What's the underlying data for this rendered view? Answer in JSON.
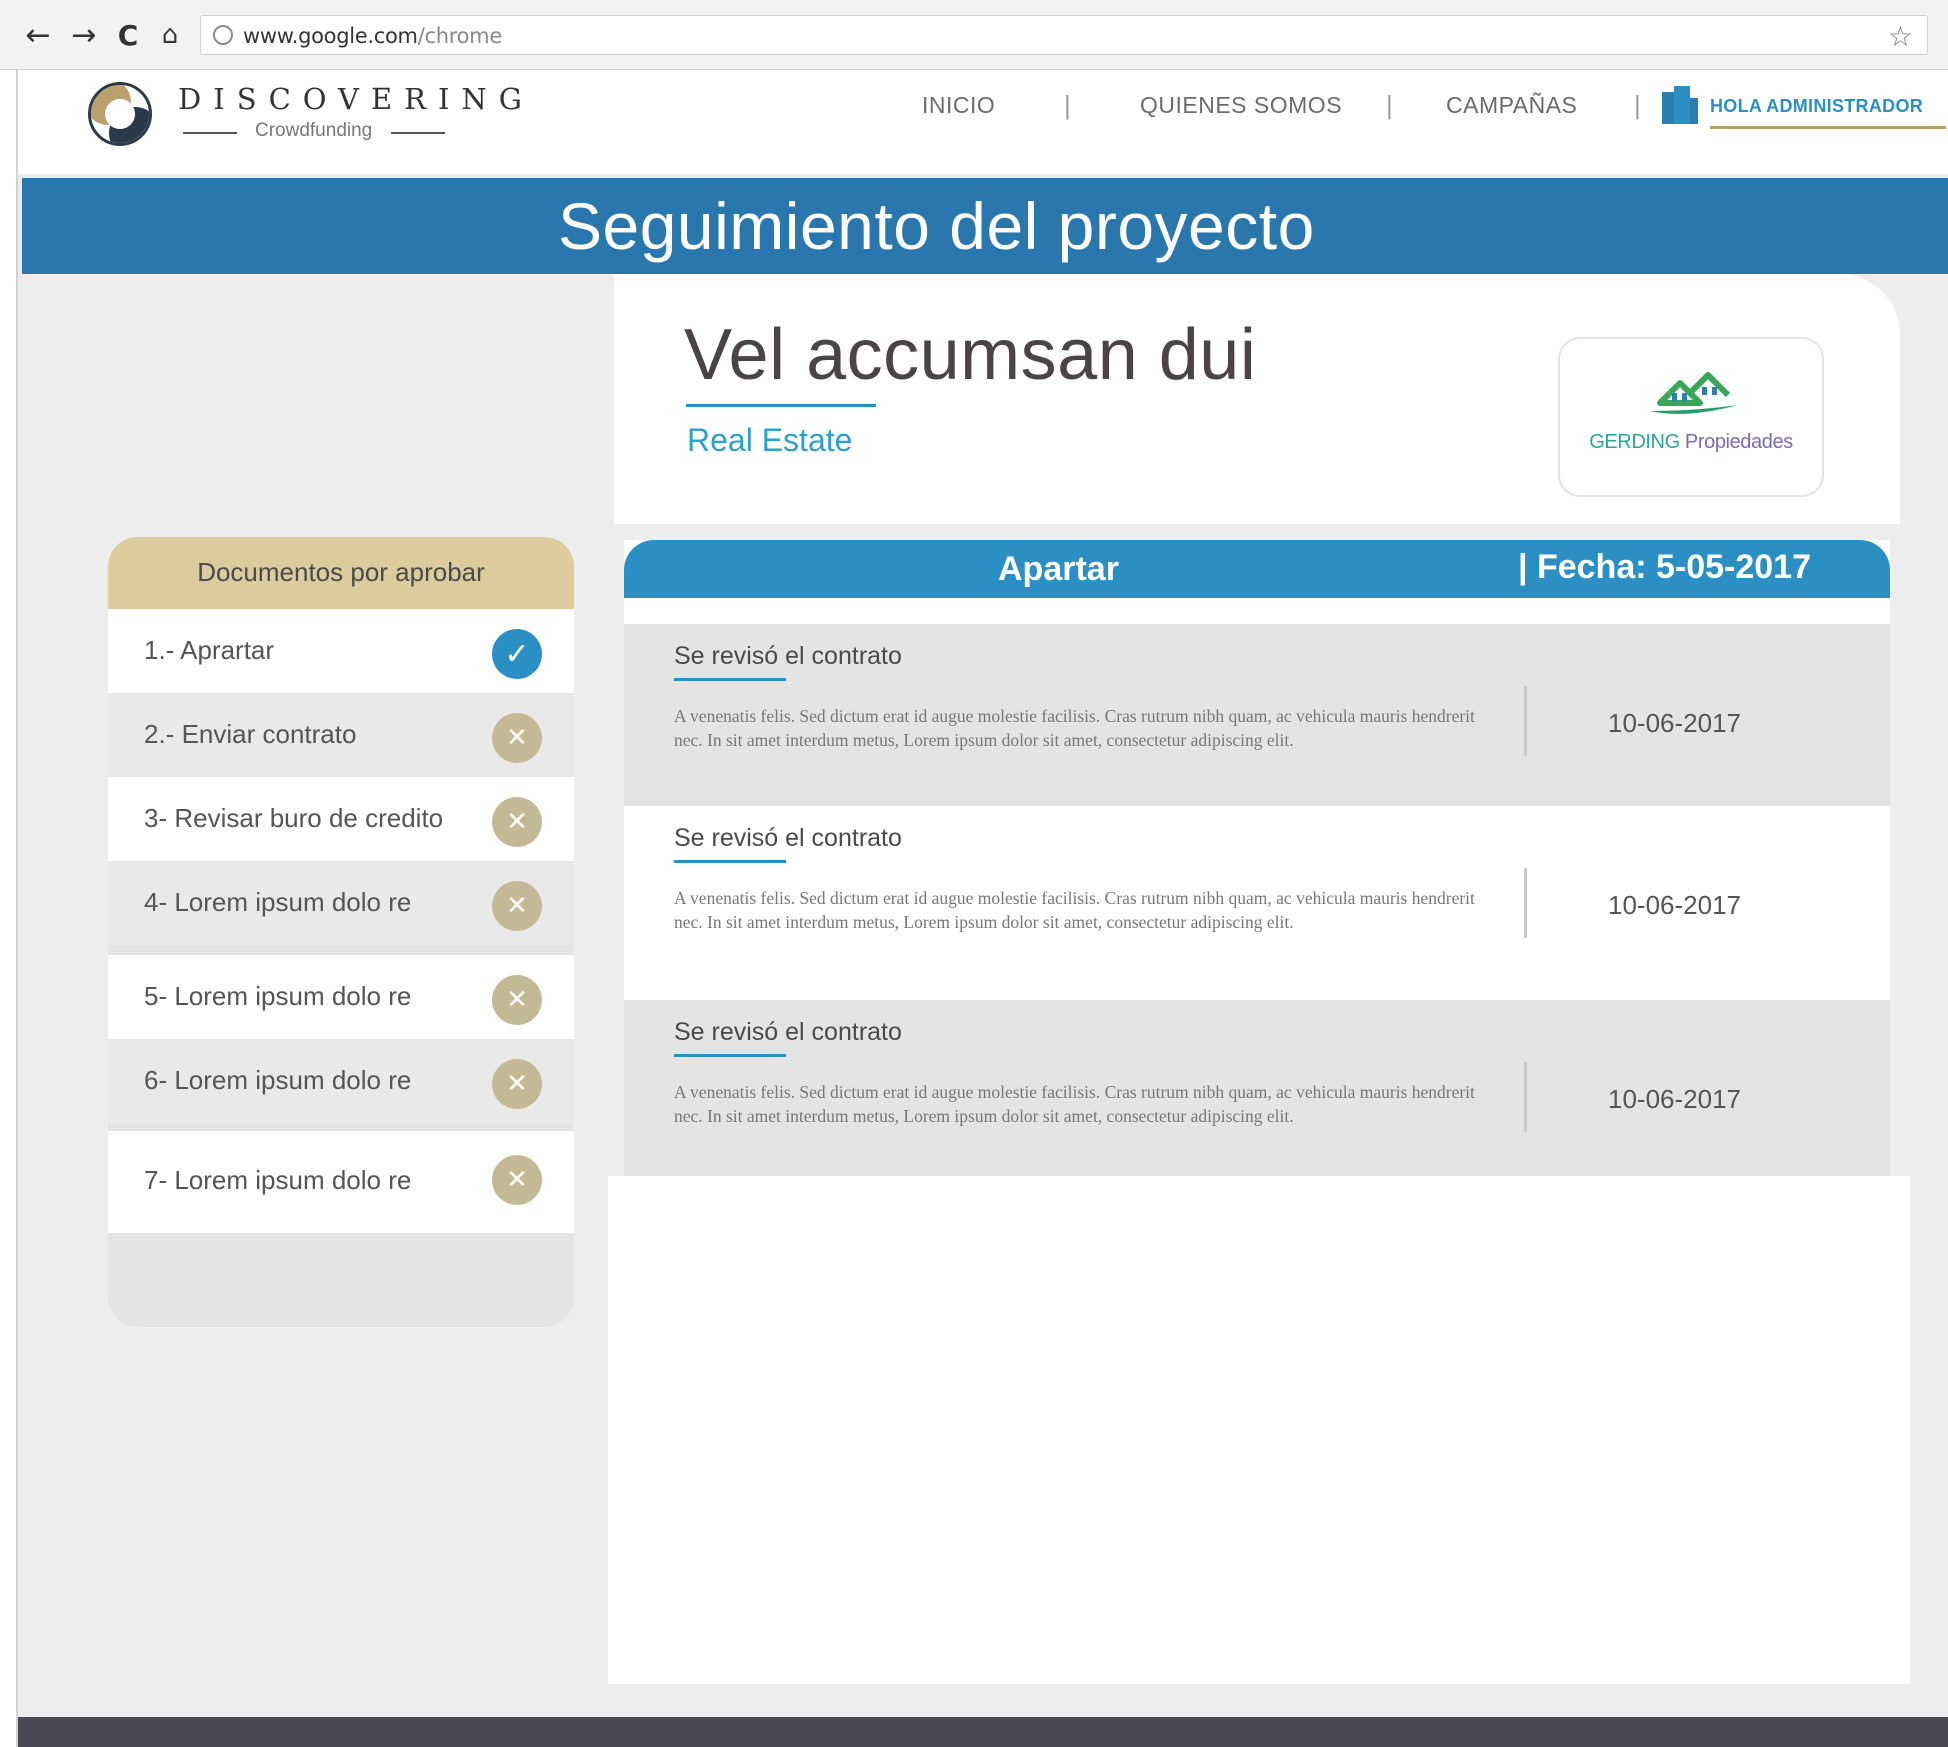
{
  "browser": {
    "back_icon": "arrow-left-icon",
    "forward_icon": "arrow-right-icon",
    "reload_icon": "reload-icon",
    "home_icon": "home-icon",
    "url_host": "www.google.com",
    "url_path": "/chrome",
    "bookmark_icon": "star-icon"
  },
  "header": {
    "brand_name": "DISCOVERING",
    "brand_tagline": "Crowdfunding",
    "nav": [
      {
        "label": "INICIO"
      },
      {
        "label": "QUIENES SOMOS"
      },
      {
        "label": "CAMPAÑAS"
      }
    ],
    "separator": "|",
    "admin_label": "HOLA ADMINISTRADOR",
    "admin_icon": "building-icon"
  },
  "title_band": {
    "title": "Seguimiento del proyecto"
  },
  "project": {
    "title": "Vel accumsan dui",
    "category": "Real Estate",
    "partner_logo": {
      "name_part1": "GERDING",
      "name_part2": " Propiedades"
    }
  },
  "sidebar": {
    "title": "Documentos por aprobar",
    "items": [
      {
        "label": "1.- Aprartar",
        "status": "done"
      },
      {
        "label": "2.- Enviar contrato",
        "status": "pending"
      },
      {
        "label": "3- Revisar buro de credito",
        "status": "pending"
      },
      {
        "label": "4- Lorem ipsum dolo re",
        "status": "pending"
      },
      {
        "label": "5- Lorem ipsum dolo re",
        "status": "pending"
      },
      {
        "label": "6- Lorem ipsum dolo re",
        "status": "pending"
      },
      {
        "label": "7- Lorem ipsum dolo re",
        "status": "pending"
      }
    ],
    "done_glyph": "✓",
    "pending_glyph": "✕"
  },
  "timeline": {
    "stage": "Apartar",
    "date_label": "| Fecha: 5-05-2017",
    "entries": [
      {
        "title": "Se revisó el contrato",
        "body": "A venenatis felis. Sed dictum erat id augue molestie facilisis. Cras rutrum nibh quam, ac vehicula mauris hendrerit nec. In sit amet interdum metus,  Lorem ipsum dolor sit amet, consectetur adipiscing elit.",
        "date": "10-06-2017"
      },
      {
        "title": "Se revisó el contrato",
        "body": "A venenatis felis. Sed dictum erat id augue molestie facilisis. Cras rutrum nibh quam, ac vehicula mauris hendrerit nec. In sit amet interdum metus,  Lorem ipsum dolor sit amet, consectetur adipiscing elit.",
        "date": "10-06-2017"
      },
      {
        "title": "Se revisó el contrato",
        "body": "A venenatis felis. Sed dictum erat id augue molestie facilisis. Cras rutrum nibh quam, ac vehicula mauris hendrerit nec. In sit amet interdum metus,  Lorem ipsum dolor sit amet, consectetur adipiscing elit.",
        "date": "10-06-2017"
      }
    ]
  },
  "colors": {
    "accent_blue": "#2b8fc4",
    "band_blue": "#2a77ad",
    "gold": "#dccb9d",
    "pending_badge": "#c4b995",
    "footer": "#4a4b52"
  }
}
